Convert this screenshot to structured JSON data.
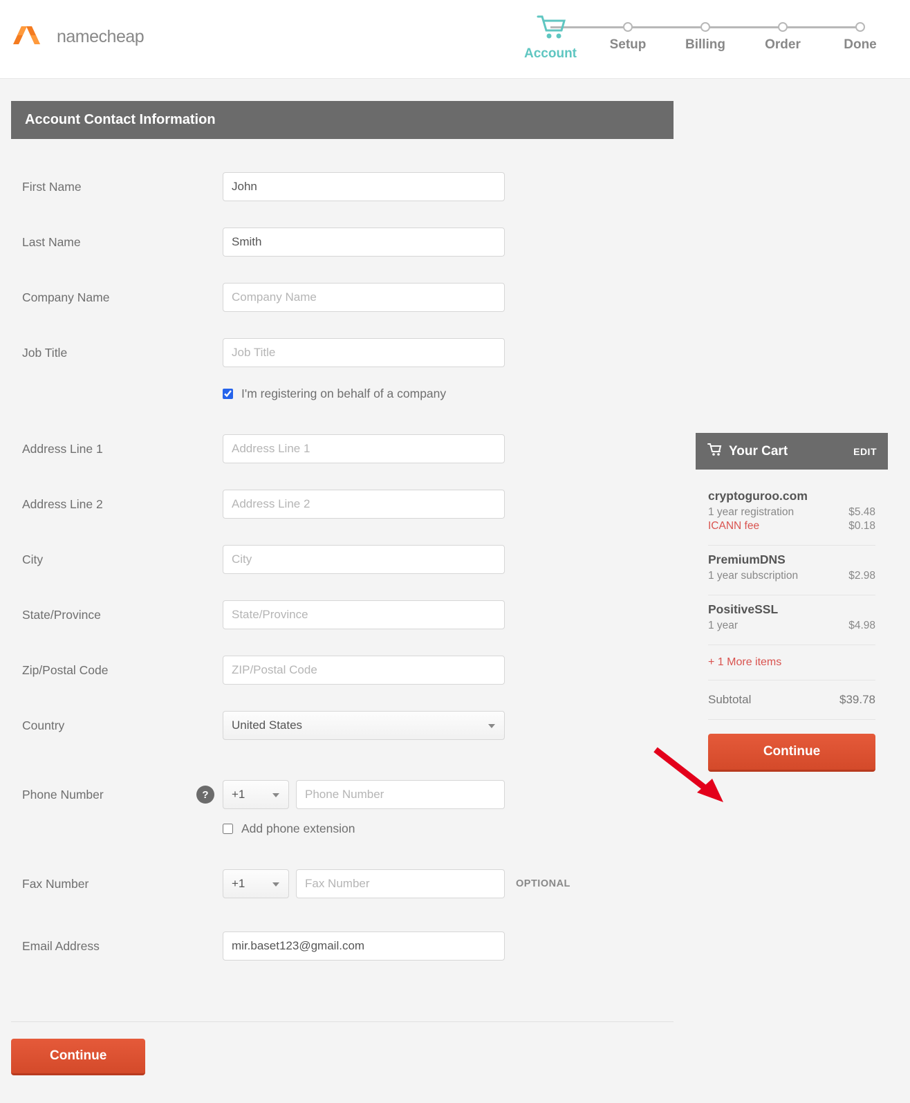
{
  "brand": {
    "name": "namecheap"
  },
  "stepper": {
    "steps": [
      "Account",
      "Setup",
      "Billing",
      "Order",
      "Done"
    ],
    "active": 0
  },
  "panel": {
    "title": "Account Contact Information"
  },
  "form": {
    "first_name": {
      "label": "First Name",
      "value": "John"
    },
    "last_name": {
      "label": "Last Name",
      "value": "Smith"
    },
    "company": {
      "label": "Company Name",
      "placeholder": "Company Name"
    },
    "job_title": {
      "label": "Job Title",
      "placeholder": "Job Title"
    },
    "on_behalf": {
      "label": "I'm registering on behalf of a company",
      "checked": true
    },
    "addr1": {
      "label": "Address Line 1",
      "placeholder": "Address Line 1"
    },
    "addr2": {
      "label": "Address Line 2",
      "placeholder": "Address Line 2"
    },
    "city": {
      "label": "City",
      "placeholder": "City"
    },
    "state": {
      "label": "State/Province",
      "placeholder": "State/Province"
    },
    "zip": {
      "label": "Zip/Postal Code",
      "placeholder": "ZIP/Postal Code"
    },
    "country": {
      "label": "Country",
      "value": "United States"
    },
    "phone": {
      "label": "Phone Number",
      "cc": "+1",
      "placeholder": "Phone Number"
    },
    "phone_ext": {
      "label": "Add phone extension",
      "checked": false
    },
    "fax": {
      "label": "Fax Number",
      "cc": "+1",
      "placeholder": "Fax Number",
      "optional": "OPTIONAL"
    },
    "email": {
      "label": "Email Address",
      "value": "mir.baset123@gmail.com"
    }
  },
  "continue_label": "Continue",
  "cart": {
    "title": "Your Cart",
    "edit": "EDIT",
    "items": [
      {
        "title": "cryptoguroo.com",
        "sub": "1 year registration",
        "price": "$5.48",
        "fee_label": "ICANN fee",
        "fee_price": "$0.18"
      },
      {
        "title": "PremiumDNS",
        "sub": "1 year subscription",
        "price": "$2.98"
      },
      {
        "title": "PositiveSSL",
        "sub": "1 year",
        "price": "$4.98"
      }
    ],
    "more": "+ 1 More items",
    "subtotal_label": "Subtotal",
    "subtotal_value": "$39.78",
    "continue": "Continue"
  }
}
